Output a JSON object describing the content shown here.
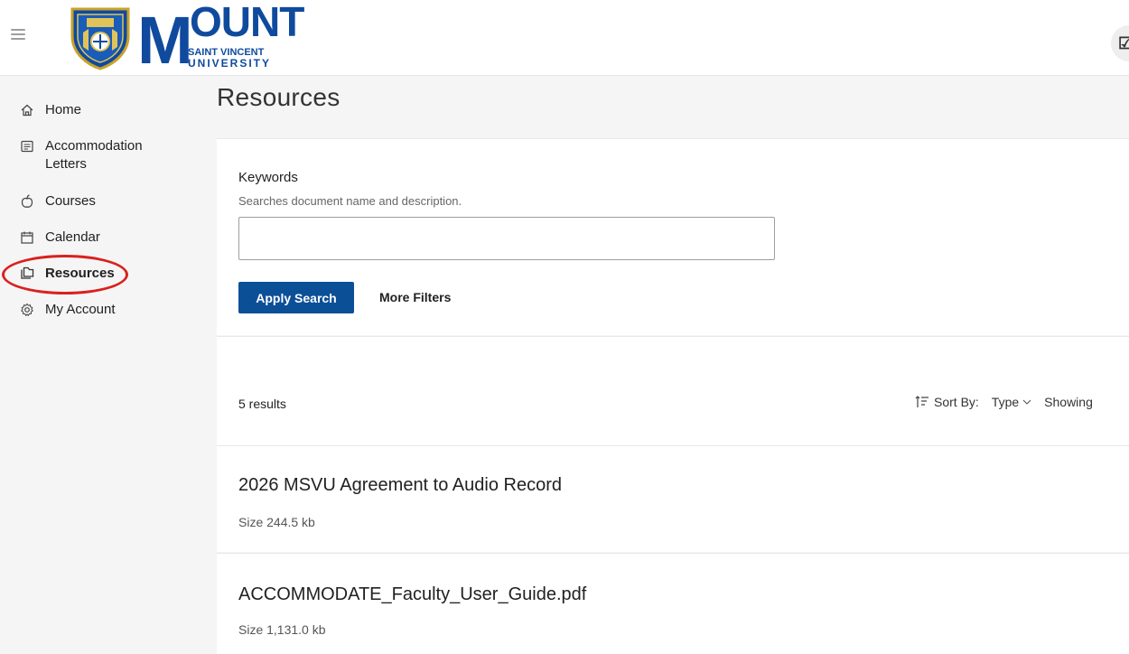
{
  "header": {
    "logo_word": "OUNT",
    "logo_initial": "M",
    "logo_line1": "SAINT VINCENT",
    "logo_line2": "UNIVERSITY",
    "right_icon_glyph": "☑"
  },
  "sidebar": {
    "items": [
      {
        "label": "Home",
        "icon": "home-icon"
      },
      {
        "label": "Accommodation Letters",
        "icon": "letters-icon"
      },
      {
        "label": "Courses",
        "icon": "apple-icon"
      },
      {
        "label": "Calendar",
        "icon": "calendar-icon"
      },
      {
        "label": "Resources",
        "icon": "folder-icon",
        "active": true
      },
      {
        "label": "My Account",
        "icon": "gear-icon"
      }
    ]
  },
  "main": {
    "title": "Resources",
    "search": {
      "keywords_label": "Keywords",
      "keywords_help": "Searches document name and description.",
      "keywords_value": "",
      "apply_label": "Apply Search",
      "more_filters_label": "More Filters"
    },
    "results": {
      "count_text": "5 results",
      "sort_label": "Sort By:",
      "sort_value": "Type",
      "showing_label": "Showing"
    },
    "items": [
      {
        "title": "2026 MSVU Agreement to Audio Record",
        "size": "Size 244.5 kb"
      },
      {
        "title": "ACCOMMODATE_Faculty_User_Guide.pdf",
        "size": "Size 1,131.0 kb"
      }
    ]
  },
  "colors": {
    "brand_blue": "#0f4a9e",
    "button_blue": "#0b4f97",
    "highlight_red": "#d9211f"
  }
}
